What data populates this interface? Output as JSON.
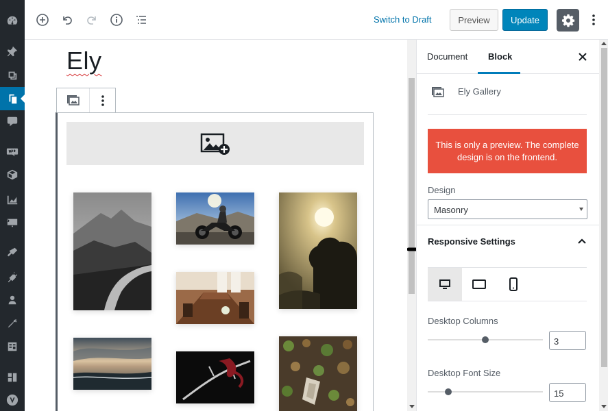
{
  "admin_menu": [
    {
      "icon": "dashboard-icon"
    },
    {
      "icon": "pin-icon"
    },
    {
      "icon": "media-icon"
    },
    {
      "icon": "pages-icon",
      "active": true
    },
    {
      "icon": "comments-icon"
    },
    {
      "icon": "woocommerce-icon"
    },
    {
      "icon": "products-icon"
    },
    {
      "icon": "analytics-icon"
    },
    {
      "icon": "marketing-icon"
    },
    {
      "icon": "appearance-icon"
    },
    {
      "icon": "plugins-icon"
    },
    {
      "icon": "users-icon"
    },
    {
      "icon": "tools-icon"
    },
    {
      "icon": "settings-icon"
    },
    {
      "icon": "layout-icon"
    },
    {
      "icon": "theme-logo-icon"
    }
  ],
  "toolbar": {
    "switch_draft": "Switch to Draft",
    "preview": "Preview",
    "update": "Update"
  },
  "editor": {
    "title": "Ely"
  },
  "gallery_images": [
    {
      "name": "mountain-road-photo"
    },
    {
      "name": "motorcycle-photo"
    },
    {
      "name": "foggy-tree-photo"
    },
    {
      "name": "cafe-table-photo"
    },
    {
      "name": "sea-sunset-photo"
    },
    {
      "name": "red-ribbon-branch-photo"
    },
    {
      "name": "forest-floor-photo"
    }
  ],
  "sidebar": {
    "tabs": [
      "Document",
      "Block"
    ],
    "active_tab": "Block",
    "block_name": "Ely Gallery",
    "notice": "This is only a preview. The complete design is on the frontend.",
    "design_label": "Design",
    "design_value": "Masonry",
    "responsive_title": "Responsive Settings",
    "devices": [
      "desktop-icon",
      "tablet-icon",
      "mobile-icon"
    ],
    "desktop_columns_label": "Desktop Columns",
    "desktop_columns_value": "3",
    "desktop_font_size_label": "Desktop Font Size",
    "desktop_font_size_value": "15"
  },
  "colors": {
    "accent": "#0085ba",
    "notice": "#e8503e",
    "admin_bg": "#23282d"
  }
}
